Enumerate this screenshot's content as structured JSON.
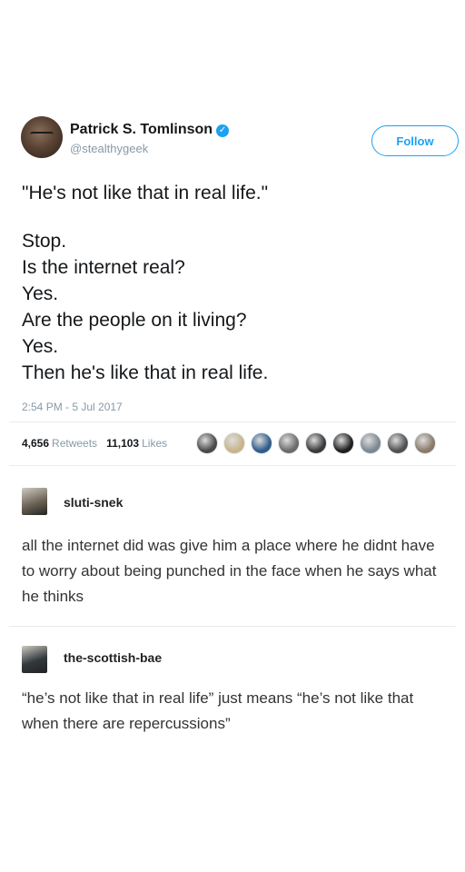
{
  "tweet": {
    "author_name": "Patrick S. Tomlinson",
    "handle": "@stealthygeek",
    "follow_label": "Follow",
    "lines": [
      "\"He's not like that in real life.\"",
      "",
      "Stop.",
      "Is the internet real?",
      "Yes.",
      "Are the people on it living?",
      "Yes.",
      "Then he's like that in real life."
    ],
    "timestamp": "2:54 PM - 5 Jul 2017",
    "retweets_count": "4,656",
    "retweets_label": "Retweets",
    "likes_count": "11,103",
    "likes_label": "Likes",
    "verified_icon": "check-badge-icon",
    "liker_colors": [
      "#4a4a4a",
      "#c9b48a",
      "#2f5d8a",
      "#6b6b6b",
      "#3a3a3a",
      "#1f1f1f",
      "#7d8791",
      "#505050",
      "#8a7a6a"
    ]
  },
  "posts": [
    {
      "username": "sluti-snek",
      "body": "all the internet did was give him a place where he didnt have to worry about being punched in the face when he says what he thinks",
      "avatar_color": "#6d6456"
    },
    {
      "username": "the-scottish-bae",
      "body": "“he’s not like that in real life” just means “he’s not like that when there are repercussions”",
      "avatar_color": "#33393d"
    }
  ]
}
